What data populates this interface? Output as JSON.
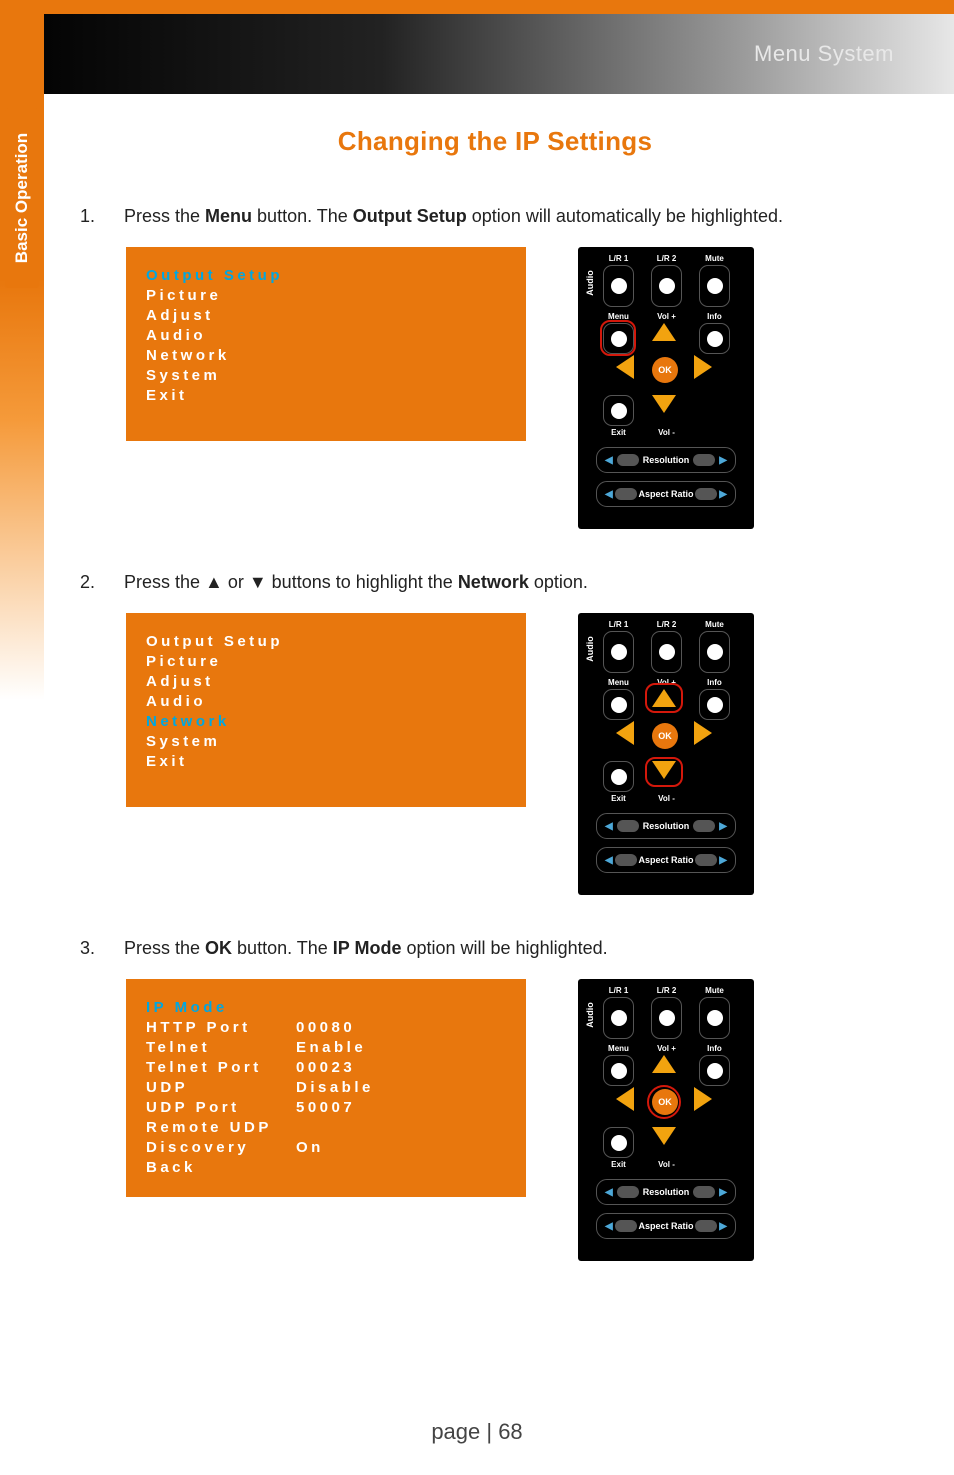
{
  "header": {
    "section": "Menu System"
  },
  "side_tab": "Basic Operation",
  "title": "Changing the IP Settings",
  "steps": [
    {
      "n": "1.",
      "pre": "Press the ",
      "b1": "Menu",
      "mid": " button.  The ",
      "b2": "Output Setup",
      "post": " option will automatically be highlighted."
    },
    {
      "n": "2.",
      "pre": "Press the ▲ or ▼ buttons to highlight the ",
      "b1": "Network",
      "mid": "",
      "b2": "",
      "post": " option."
    },
    {
      "n": "3.",
      "pre": "Press the ",
      "b1": "OK",
      "mid": " button.  The ",
      "b2": "IP Mode",
      "post": " option will be highlighted."
    }
  ],
  "osd_main": {
    "items": [
      "Output Setup",
      "Picture",
      "Adjust",
      "Audio",
      "Network",
      "System",
      "Exit"
    ]
  },
  "osd_network": {
    "rows": [
      {
        "label": "IP Mode",
        "value": ""
      },
      {
        "label": "HTTP Port",
        "value": "00080"
      },
      {
        "label": "Telnet",
        "value": "Enable"
      },
      {
        "label": "Telnet Port",
        "value": "00023"
      },
      {
        "label": "UDP",
        "value": "Disable"
      },
      {
        "label": "UDP Port",
        "value": "50007"
      },
      {
        "label": "Remote UDP",
        "value": ""
      },
      {
        "label": "Discovery",
        "value": "On"
      },
      {
        "label": "Back",
        "value": ""
      }
    ]
  },
  "remote": {
    "audio": "Audio",
    "lr1": "L/R 1",
    "lr2": "L/R 2",
    "mute": "Mute",
    "menu": "Menu",
    "volp": "Vol +",
    "info": "Info",
    "exit": "Exit",
    "volm": "Vol -",
    "ok": "OK",
    "resolution": "Resolution",
    "aspect": "Aspect Ratio"
  },
  "page": "page | 68"
}
